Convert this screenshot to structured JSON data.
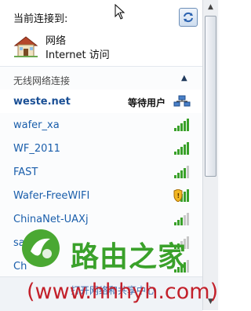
{
  "header": {
    "current_label": "当前连接到:",
    "network_name": "网络",
    "network_status": "Internet 访问"
  },
  "section": {
    "title": "无线网络连接"
  },
  "networks": [
    {
      "ssid": "weste.net",
      "status": "等待用户",
      "signal_icon": "network-computers-icon",
      "bold": true
    },
    {
      "ssid": "wafer_xa",
      "status": "",
      "signal_icon": "signal-bars-icon",
      "bold": false
    },
    {
      "ssid": "WF_2011",
      "status": "",
      "signal_icon": "signal-bars-icon",
      "bold": false
    },
    {
      "ssid": "FAST",
      "status": "",
      "signal_icon": "signal-bars-icon",
      "bold": false
    },
    {
      "ssid": "Wafer-FreeWIFI",
      "status": "",
      "signal_icon": "shield-warning-icon",
      "bold": false
    },
    {
      "ssid": "ChinaNet-UAXj",
      "status": "",
      "signal_icon": "signal-bars-icon",
      "bold": false
    },
    {
      "ssid": "sa",
      "status": "",
      "signal_icon": "signal-bars-icon",
      "bold": false
    },
    {
      "ssid": "Ch",
      "status": "",
      "signal_icon": "signal-bars-icon",
      "bold": false
    }
  ],
  "footer": {
    "link": "打开网络和共享中心"
  },
  "watermark": {
    "brand": "路由之家",
    "url_open": "(",
    "url": "www.hhhyh.com",
    "url_close": ")"
  },
  "colors": {
    "link_blue": "#1a5eab",
    "signal_green": "#3aa12a",
    "watermark_green": "#3aa12a",
    "watermark_red": "#c3202a"
  }
}
